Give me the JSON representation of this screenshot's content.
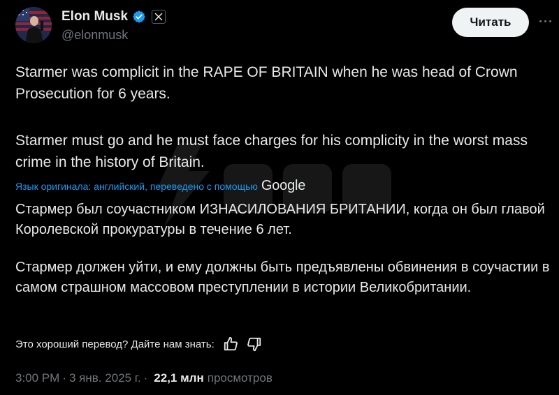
{
  "author": {
    "name": "Elon Musk",
    "handle": "@elonmusk",
    "verified_color": "#1d9bf0"
  },
  "header": {
    "read_button": "Читать"
  },
  "post": {
    "paragraph_1": "Starmer was complicit in the RAPE OF BRITAIN when he was head of Crown Prosecution for 6 years.",
    "paragraph_2": "Starmer must go and he must face charges for his complicity in the worst mass crime in the history of Britain."
  },
  "translation": {
    "note": "Язык оригинала: английский, переведено с помощью",
    "provider": "Google",
    "paragraph_1": "Стармер был соучастником ИЗНАСИЛОВАНИЯ БРИТАНИИ, когда он был главой Королевской прокуратуры в течение 6 лет.",
    "paragraph_2": "Стармер должен уйти, и ему должны быть предъявлены обвинения в соучастии в самом страшном массовом преступлении в истории Великобритании.",
    "feedback_prompt": "Это хороший перевод? Дайте нам знать:"
  },
  "meta": {
    "time": "3:00 PM",
    "separator": "·",
    "date": "3 янв. 2025 г.",
    "views_count": "22,1 млн",
    "views_label": "просмотров"
  },
  "icons": {
    "verified": "verified-badge-icon",
    "x_logo": "x-logo-icon",
    "more": "more-options-icon",
    "thumbs_up": "thumbs-up-icon",
    "thumbs_down": "thumbs-down-icon"
  },
  "colors": {
    "background": "#000000",
    "text": "#e7e9ea",
    "muted": "#71767b",
    "link": "#1d9bf0"
  }
}
